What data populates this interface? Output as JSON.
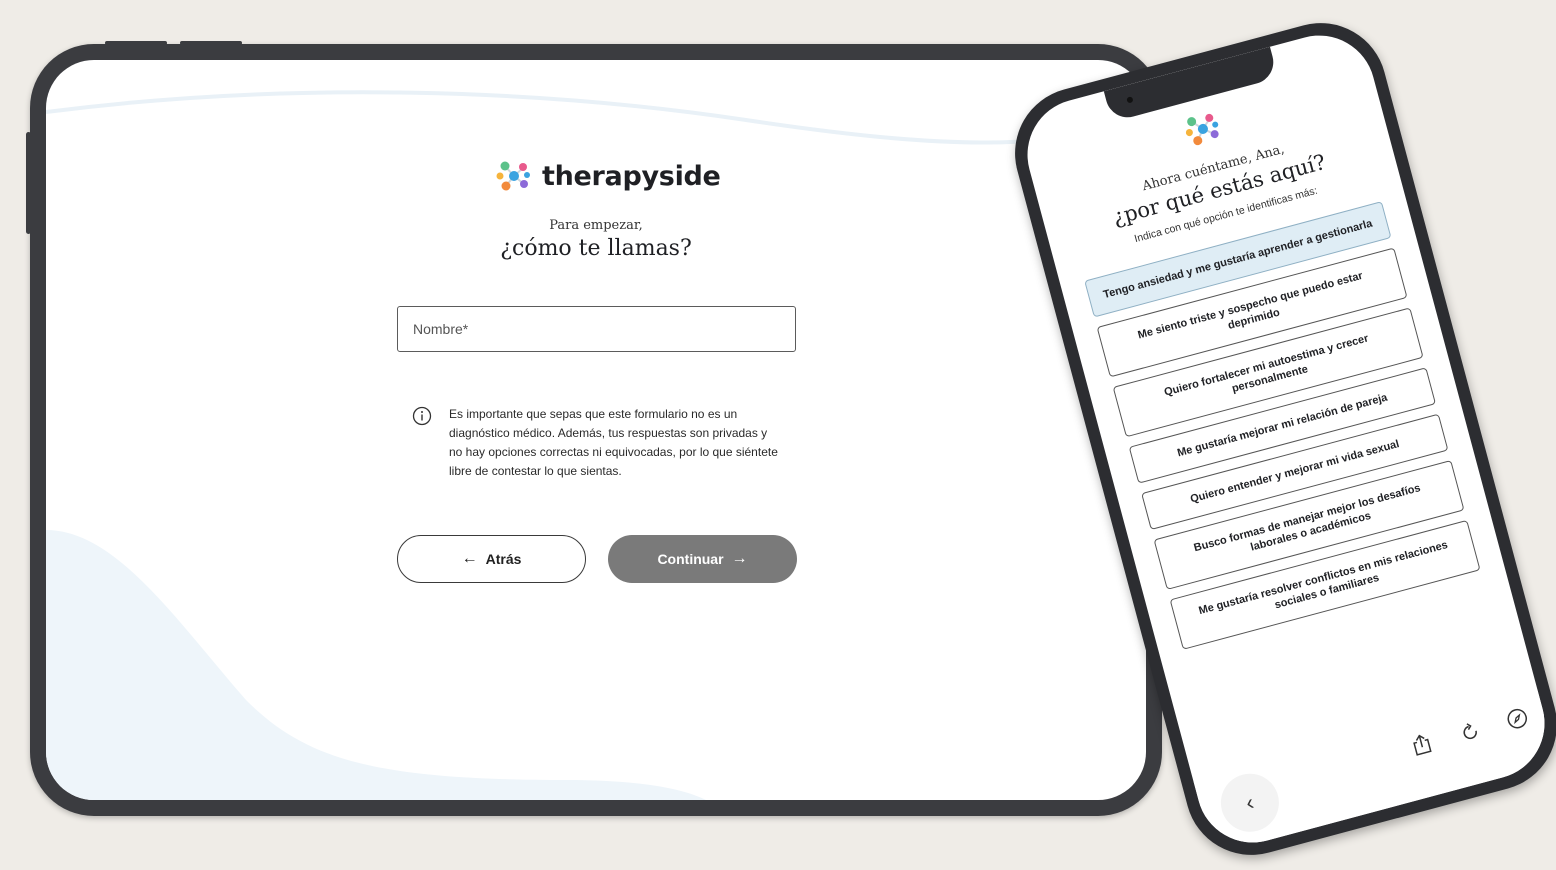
{
  "tablet": {
    "logo": {
      "text": "therapyside"
    },
    "subtitle": "Para empezar,",
    "title": "¿cómo te llamas?",
    "name_input": {
      "placeholder": "Nombre*",
      "value": ""
    },
    "info": {
      "icon": "info-circle-icon",
      "text": "Es importante que sepas que este formulario no es un diagnóstico médico. Además, tus respuestas son privadas y no hay opciones correctas ni equivocadas, por lo que siéntete libre de contestar lo que sientas."
    },
    "back_button": {
      "label": "Atrás",
      "arrow": "←"
    },
    "continue_button": {
      "label": "Continuar",
      "arrow": "→"
    }
  },
  "phone": {
    "subtitle": "Ahora cuéntame, Ana,",
    "title": "¿por qué estás aquí?",
    "hint": "Indica con qué opción te identificas más:",
    "options": [
      {
        "label": "Tengo ansiedad y me gustaría aprender a gestionarla",
        "selected": true
      },
      {
        "label": "Me siento triste y sospecho que puedo estar deprimido",
        "selected": false
      },
      {
        "label": "Quiero fortalecer mi autoestima y crecer personalmente",
        "selected": false
      },
      {
        "label": "Me gustaría mejorar mi relación de pareja",
        "selected": false
      },
      {
        "label": "Quiero entender y mejorar mi vida sexual",
        "selected": false
      },
      {
        "label": "Busco formas de manejar mejor los desafíos laborales o académicos",
        "selected": false
      },
      {
        "label": "Me gustaría resolver conflictos en mis relaciones sociales o familiares",
        "selected": false
      }
    ],
    "toolbar": {
      "back_glyph": "‹",
      "share_icon": "share-icon",
      "reload_icon": "reload-icon",
      "compass_icon": "compass-icon"
    }
  },
  "colors": {
    "background": "#efece7",
    "device_frame": "#3b3c40",
    "selected_option": "#dfedf5",
    "continue_button": "#7a7a7a",
    "wave": "#eaf3f9",
    "logo_dots": [
      "#f6b43c",
      "#e85a8c",
      "#5cc28a",
      "#3aa3e0",
      "#8c6ad8",
      "#f28a3c"
    ]
  }
}
